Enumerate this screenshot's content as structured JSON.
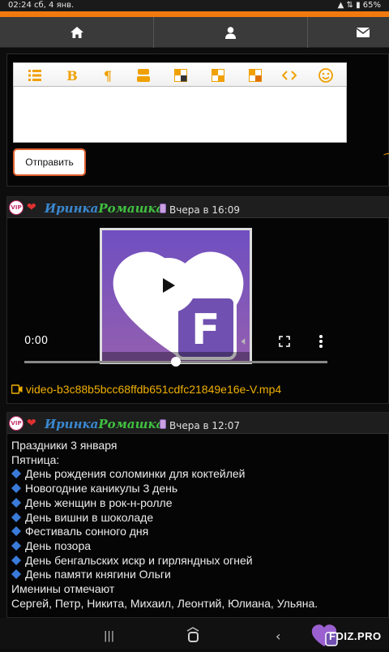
{
  "status": {
    "time": "02:24",
    "date": "сб, 4 янв.",
    "battery": "65%"
  },
  "nav": {
    "home_icon": "home-icon",
    "user_icon": "user-icon",
    "mail_icon": "mail-icon"
  },
  "composer": {
    "toolbar_icons": [
      "list-icon",
      "bold-icon",
      "paragraph-icon",
      "youtube-icon",
      "table-icon",
      "table-icon-2",
      "table-icon-3",
      "code-icon",
      "smile-icon"
    ],
    "bold_label": "B",
    "paragraph_label": "¶",
    "send_label": "Отправить"
  },
  "posts": [
    {
      "vip": "VIP",
      "user_part1": "Иринка",
      "user_part2": "Ромашка",
      "when": "Вчера в 16:09",
      "video_time": "0:00",
      "video_progress": 0.5,
      "file": "video-b3c88b5bcc68ffdb651cdfc21849e16e-V.mp4"
    },
    {
      "vip": "VIP",
      "user_part1": "Иринка",
      "user_part2": "Ромашка",
      "when": "Вчера в 12:07",
      "lines": [
        "Праздники 3 января",
        "Пятница:",
        "День рождения соломинки для коктейлей",
        "Новогодние каникулы 3 день",
        "День женщин в рок-н-ролле",
        "День вишни в шоколаде",
        "Фестиваль сонного дня",
        "День позора",
        "День бенгальских искр и гирляндных огней",
        "День памяти княгини Ольги",
        "Именины отмечают",
        "Сергей, Петр, Никита, Михаил, Леонтий, Юлиана, Ульяна."
      ]
    }
  ],
  "logo_text": "FDIZ.PRO",
  "colors": {
    "accent": "#f07a10",
    "link": "#f0b000",
    "name1": "#3a88d0",
    "name2": "#40c040"
  }
}
